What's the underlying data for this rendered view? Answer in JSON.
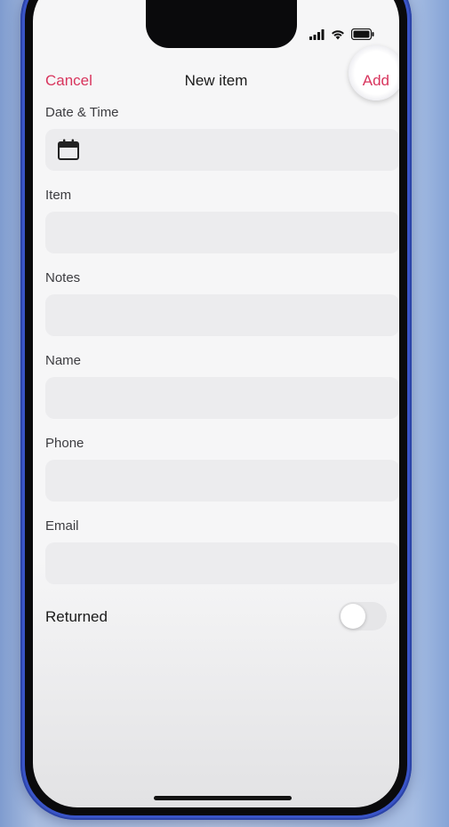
{
  "nav": {
    "cancel_label": "Cancel",
    "title": "New item",
    "add_label": "Add"
  },
  "form": {
    "date_label": "Date & Time",
    "item_label": "Item",
    "item_value": "",
    "notes_label": "Notes",
    "notes_value": "",
    "name_label": "Name",
    "name_value": "",
    "phone_label": "Phone",
    "phone_value": "",
    "email_label": "Email",
    "email_value": "",
    "returned_label": "Returned",
    "returned_on": false
  },
  "colors": {
    "accent": "#d8355d",
    "field_bg": "#ececee",
    "frame": "#3a55c8"
  },
  "icons": {
    "calendar": "calendar-icon",
    "signal": "signal-icon",
    "wifi": "wifi-icon",
    "battery": "battery-icon"
  }
}
